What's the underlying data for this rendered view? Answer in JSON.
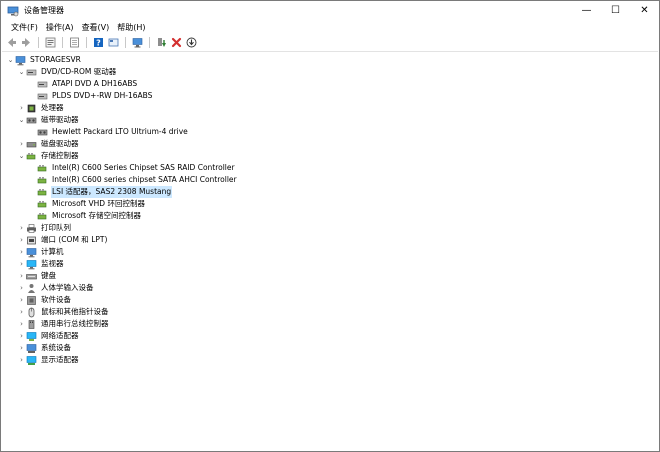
{
  "window": {
    "title": "设备管理器",
    "controls": {
      "minimize": "—",
      "maximize": "☐",
      "close": "✕"
    }
  },
  "menu": {
    "items": [
      "文件(F)",
      "操作(A)",
      "查看(V)",
      "帮助(H)"
    ]
  },
  "toolbar": {
    "buttons": [
      "back-icon",
      "forward-icon",
      "properties-icon",
      "details-icon",
      "help-icon",
      "view-icon",
      "scan-icon",
      "update-driver-icon",
      "uninstall-icon",
      "download-icon"
    ]
  },
  "tree": {
    "root": {
      "label": "STORAGESVR",
      "icon": "computer-icon"
    },
    "nodes": [
      {
        "label": "DVD/CD-ROM 驱动器",
        "icon": "dvd-icon",
        "expanded": true,
        "children": [
          "ATAPI DVD A  DH16ABS",
          "PLDS DVD+-RW DH-16ABS"
        ]
      },
      {
        "label": "处理器",
        "icon": "processor-icon",
        "expanded": false
      },
      {
        "label": "磁带驱动器",
        "icon": "tape-icon",
        "expanded": true,
        "children": [
          "Hewlett Packard LTO Ultrium-4 drive"
        ]
      },
      {
        "label": "磁盘驱动器",
        "icon": "disk-icon",
        "expanded": false
      },
      {
        "label": "存储控制器",
        "icon": "storage-icon",
        "expanded": true,
        "children": [
          "Intel(R) C600 Series Chipset SAS RAID Controller",
          "Intel(R) C600 series chipset SATA AHCI Controller",
          "LSI 适配器，SAS2 2308 Mustang",
          "Microsoft VHD 环回控制器",
          "Microsoft 存储空间控制器"
        ],
        "selected_child": 2
      },
      {
        "label": "打印队列",
        "icon": "printer-icon",
        "expanded": false
      },
      {
        "label": "端口 (COM 和 LPT)",
        "icon": "port-icon",
        "expanded": false
      },
      {
        "label": "计算机",
        "icon": "computer-icon",
        "expanded": false
      },
      {
        "label": "监视器",
        "icon": "monitor-icon",
        "expanded": false
      },
      {
        "label": "键盘",
        "icon": "keyboard-icon",
        "expanded": false
      },
      {
        "label": "人体学输入设备",
        "icon": "hid-icon",
        "expanded": false
      },
      {
        "label": "软件设备",
        "icon": "software-icon",
        "expanded": false
      },
      {
        "label": "鼠标和其他指针设备",
        "icon": "mouse-icon",
        "expanded": false
      },
      {
        "label": "通用串行总线控制器",
        "icon": "usb-icon",
        "expanded": false
      },
      {
        "label": "网络适配器",
        "icon": "network-icon",
        "expanded": false
      },
      {
        "label": "系统设备",
        "icon": "system-icon",
        "expanded": false
      },
      {
        "label": "显示适配器",
        "icon": "display-icon",
        "expanded": false
      }
    ]
  },
  "colors": {
    "selection": "#cce8ff",
    "back_arrow": "#2e7d32",
    "help_blue": "#1565c0",
    "uninstall_red": "#d32f2f"
  }
}
